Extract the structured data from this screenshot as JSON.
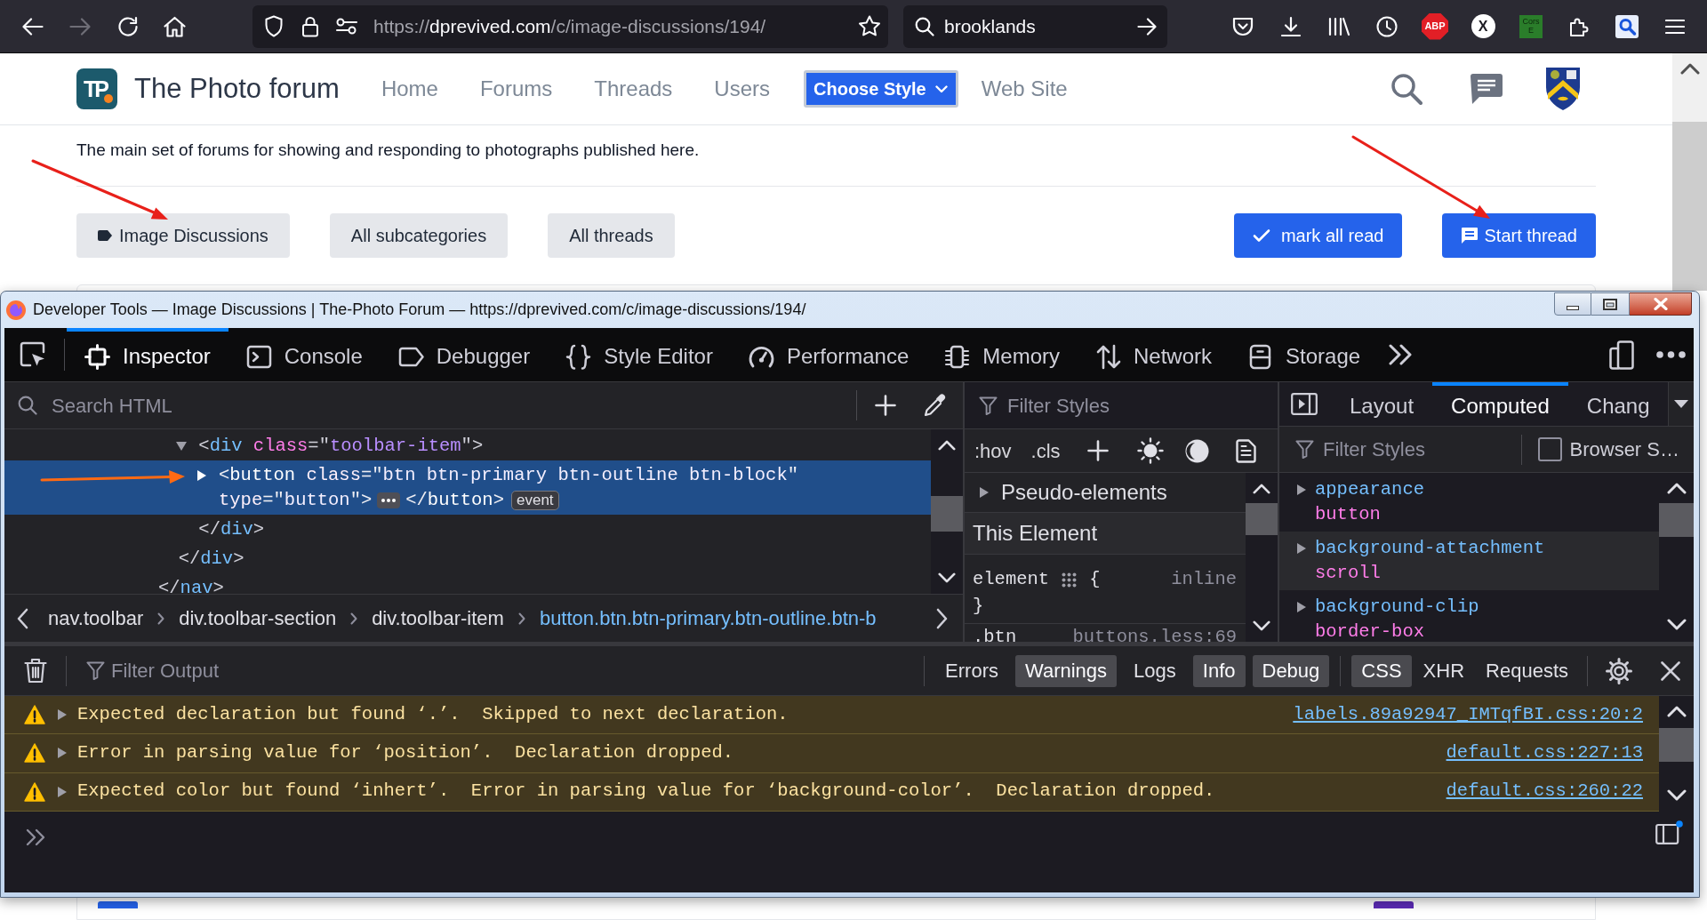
{
  "browser": {
    "back": {
      "disabled": false
    },
    "forward": {
      "disabled": true
    },
    "url": {
      "scheme": "https://",
      "host": "dprevived.com",
      "path": "/c/image-discussions/194/"
    },
    "search": {
      "value": "brooklands"
    },
    "extensions": [
      "ABP",
      "X",
      "Cors E"
    ]
  },
  "page": {
    "logo": "TP",
    "title": "The Photo forum",
    "nav": [
      {
        "label": "Home",
        "kind": "link"
      },
      {
        "label": "Forums",
        "kind": "link"
      },
      {
        "label": "Threads",
        "kind": "link"
      },
      {
        "label": "Users",
        "kind": "link"
      },
      {
        "label": "Choose Style",
        "kind": "dropdown"
      },
      {
        "label": "Web Site",
        "kind": "link"
      }
    ],
    "description": "The main set of forums for showing and responding to photographs published here.",
    "filters": [
      {
        "label": "Image Discussions",
        "kind": "category"
      },
      {
        "label": "All subcategories",
        "kind": "link"
      },
      {
        "label": "All threads",
        "kind": "link"
      }
    ],
    "actions": [
      {
        "label": "mark all read"
      },
      {
        "label": "Start thread"
      }
    ]
  },
  "devtools": {
    "title": "Developer Tools — Image Discussions | The-Photo Forum — https://dprevived.com/c/image-discussions/194/",
    "tabs": [
      {
        "label": "Inspector",
        "selected": true
      },
      {
        "label": "Console",
        "selected": false
      },
      {
        "label": "Debugger",
        "selected": false
      },
      {
        "label": "Style Editor",
        "selected": false
      },
      {
        "label": "Performance",
        "selected": false
      },
      {
        "label": "Memory",
        "selected": false
      },
      {
        "label": "Network",
        "selected": false
      },
      {
        "label": "Storage",
        "selected": false
      }
    ],
    "inspector": {
      "search_placeholder": "Search HTML",
      "markup": [
        {
          "selected": false,
          "closing": [
            {
              "kind": "punct",
              "text": "</"
            },
            {
              "kind": "tag",
              "text": "nav"
            },
            {
              "kind": "punct",
              "text": ">"
            }
          ],
          "children": [
            {
              "selected": false,
              "closing": [
                {
                  "kind": "punct",
                  "text": "</"
                },
                {
                  "kind": "tag",
                  "text": "div"
                },
                {
                  "kind": "punct",
                  "text": ">"
                }
              ],
              "children": [
                {
                  "selected": false,
                  "expanded": true,
                  "open": [
                    [
                      {
                        "kind": "punct",
                        "text": "<"
                      },
                      {
                        "kind": "tag",
                        "text": "div"
                      },
                      {
                        "kind": "attr",
                        "text": " class"
                      },
                      {
                        "kind": "punct",
                        "text": "=\""
                      },
                      {
                        "kind": "value",
                        "text": "toolbar-item"
                      },
                      {
                        "kind": "punct",
                        "text": "\">"
                      }
                    ]
                  ],
                  "closing": [
                    {
                      "kind": "punct",
                      "text": "</"
                    },
                    {
                      "kind": "tag",
                      "text": "div"
                    },
                    {
                      "kind": "punct",
                      "text": ">"
                    }
                  ],
                  "children": [
                    {
                      "selected": true,
                      "expanded": false,
                      "open": [
                        [
                          {
                            "kind": "punct",
                            "text": "<"
                          },
                          {
                            "kind": "tag",
                            "text": "button"
                          },
                          {
                            "kind": "attr",
                            "text": " class"
                          },
                          {
                            "kind": "punct",
                            "text": "=\""
                          },
                          {
                            "kind": "value",
                            "text": "btn btn-primary btn-outline btn-block"
                          },
                          {
                            "kind": "punct",
                            "text": "\""
                          }
                        ],
                        [
                          {
                            "kind": "attr",
                            "text": "type"
                          },
                          {
                            "kind": "punct",
                            "text": "=\""
                          },
                          {
                            "kind": "value",
                            "text": "button"
                          },
                          {
                            "kind": "punct",
                            "text": "\">"
                          }
                        ]
                      ],
                      "closing": [
                        {
                          "kind": "punct",
                          "text": "</"
                        },
                        {
                          "kind": "tag",
                          "text": "button"
                        },
                        {
                          "kind": "punct",
                          "text": ">"
                        }
                      ],
                      "badges": [
                        "event"
                      ]
                    }
                  ]
                }
              ]
            }
          ]
        }
      ],
      "breadcrumbs": [
        {
          "label": "nav.toolbar",
          "selected": false
        },
        {
          "label": "div.toolbar-section",
          "selected": false
        },
        {
          "label": "div.toolbar-item",
          "selected": false
        },
        {
          "label": "button.btn.btn-primary.btn-outline.btn-b",
          "selected": true
        }
      ]
    },
    "rules": {
      "filter_placeholder": "Filter Styles",
      "toggles": [
        ":hov",
        ".cls"
      ],
      "pseudo_elements": {
        "label": "Pseudo-elements",
        "expanded": false
      },
      "section": "This Element",
      "rules": [
        {
          "kind": "element",
          "selector": "element",
          "open": "{",
          "source": "inline",
          "close": "}"
        },
        {
          "kind": "class",
          "selector": ".btn",
          "source": "buttons.less:69"
        }
      ]
    },
    "computed": {
      "tabs": [
        {
          "label": "Layout",
          "selected": false
        },
        {
          "label": "Computed",
          "selected": true
        },
        {
          "label": "Chang",
          "selected": false
        }
      ],
      "filter_placeholder": "Filter Styles",
      "browser_styles": {
        "label": "Browser S…",
        "checked": false
      },
      "properties": [
        {
          "name": "appearance",
          "value": "button",
          "expanded": false
        },
        {
          "name": "background-attachment",
          "value": "scroll",
          "expanded": false
        },
        {
          "name": "background-clip",
          "value": "border-box",
          "expanded": false
        }
      ]
    },
    "console": {
      "filter_placeholder": "Filter Output",
      "severity_filters": [
        {
          "label": "Errors",
          "selected": false
        },
        {
          "label": "Warnings",
          "selected": true
        },
        {
          "label": "Logs",
          "selected": false
        },
        {
          "label": "Info",
          "selected": true
        },
        {
          "label": "Debug",
          "selected": true
        }
      ],
      "type_filters": [
        {
          "label": "CSS",
          "selected": true
        },
        {
          "label": "XHR",
          "selected": false
        },
        {
          "label": "Requests",
          "selected": false
        }
      ],
      "messages": [
        {
          "kind": "warning",
          "expanded": false,
          "text": "Expected declaration but found ‘.’.  Skipped to next declaration.",
          "source": "labels.89a92947_IMTqfBI.css:20:2"
        },
        {
          "kind": "warning",
          "expanded": false,
          "text": "Error in parsing value for ‘position’.  Declaration dropped.",
          "source": "default.css:227:13"
        },
        {
          "kind": "warning",
          "expanded": false,
          "text": "Expected color but found ‘inhert’.  Error in parsing value for ‘background-color’.  Declaration dropped.",
          "source": "default.css:260:22"
        }
      ]
    }
  }
}
